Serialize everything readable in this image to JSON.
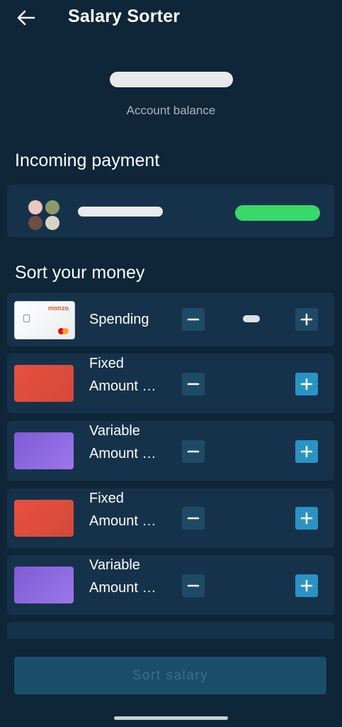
{
  "header": {
    "title": "Salary Sorter"
  },
  "balance": {
    "label": "Account balance"
  },
  "incoming": {
    "section_title": "Incoming payment"
  },
  "sort": {
    "section_title": "Sort your money",
    "pots": [
      {
        "label_line1": "Spending",
        "label_line2": "",
        "thumb": "card"
      },
      {
        "label_line1": "Fixed",
        "label_line2": "Amount …",
        "thumb": "red"
      },
      {
        "label_line1": "Variable",
        "label_line2": "Amount …",
        "thumb": "purple"
      },
      {
        "label_line1": "Fixed",
        "label_line2": "Amount …",
        "thumb": "red"
      },
      {
        "label_line1": "Variable",
        "label_line2": "Amount …",
        "thumb": "purple"
      }
    ]
  },
  "card_brand": "monzo",
  "footer": {
    "sort_button_label": "Sort salary"
  },
  "colors": {
    "background": "#0f2538",
    "row": "#16324a",
    "accent_plus": "#2a93c4",
    "button_minus": "#1f4a66",
    "incoming_amount": "#38d86a"
  },
  "icons": [
    "back-arrow-icon",
    "minus-icon",
    "plus-icon"
  ]
}
